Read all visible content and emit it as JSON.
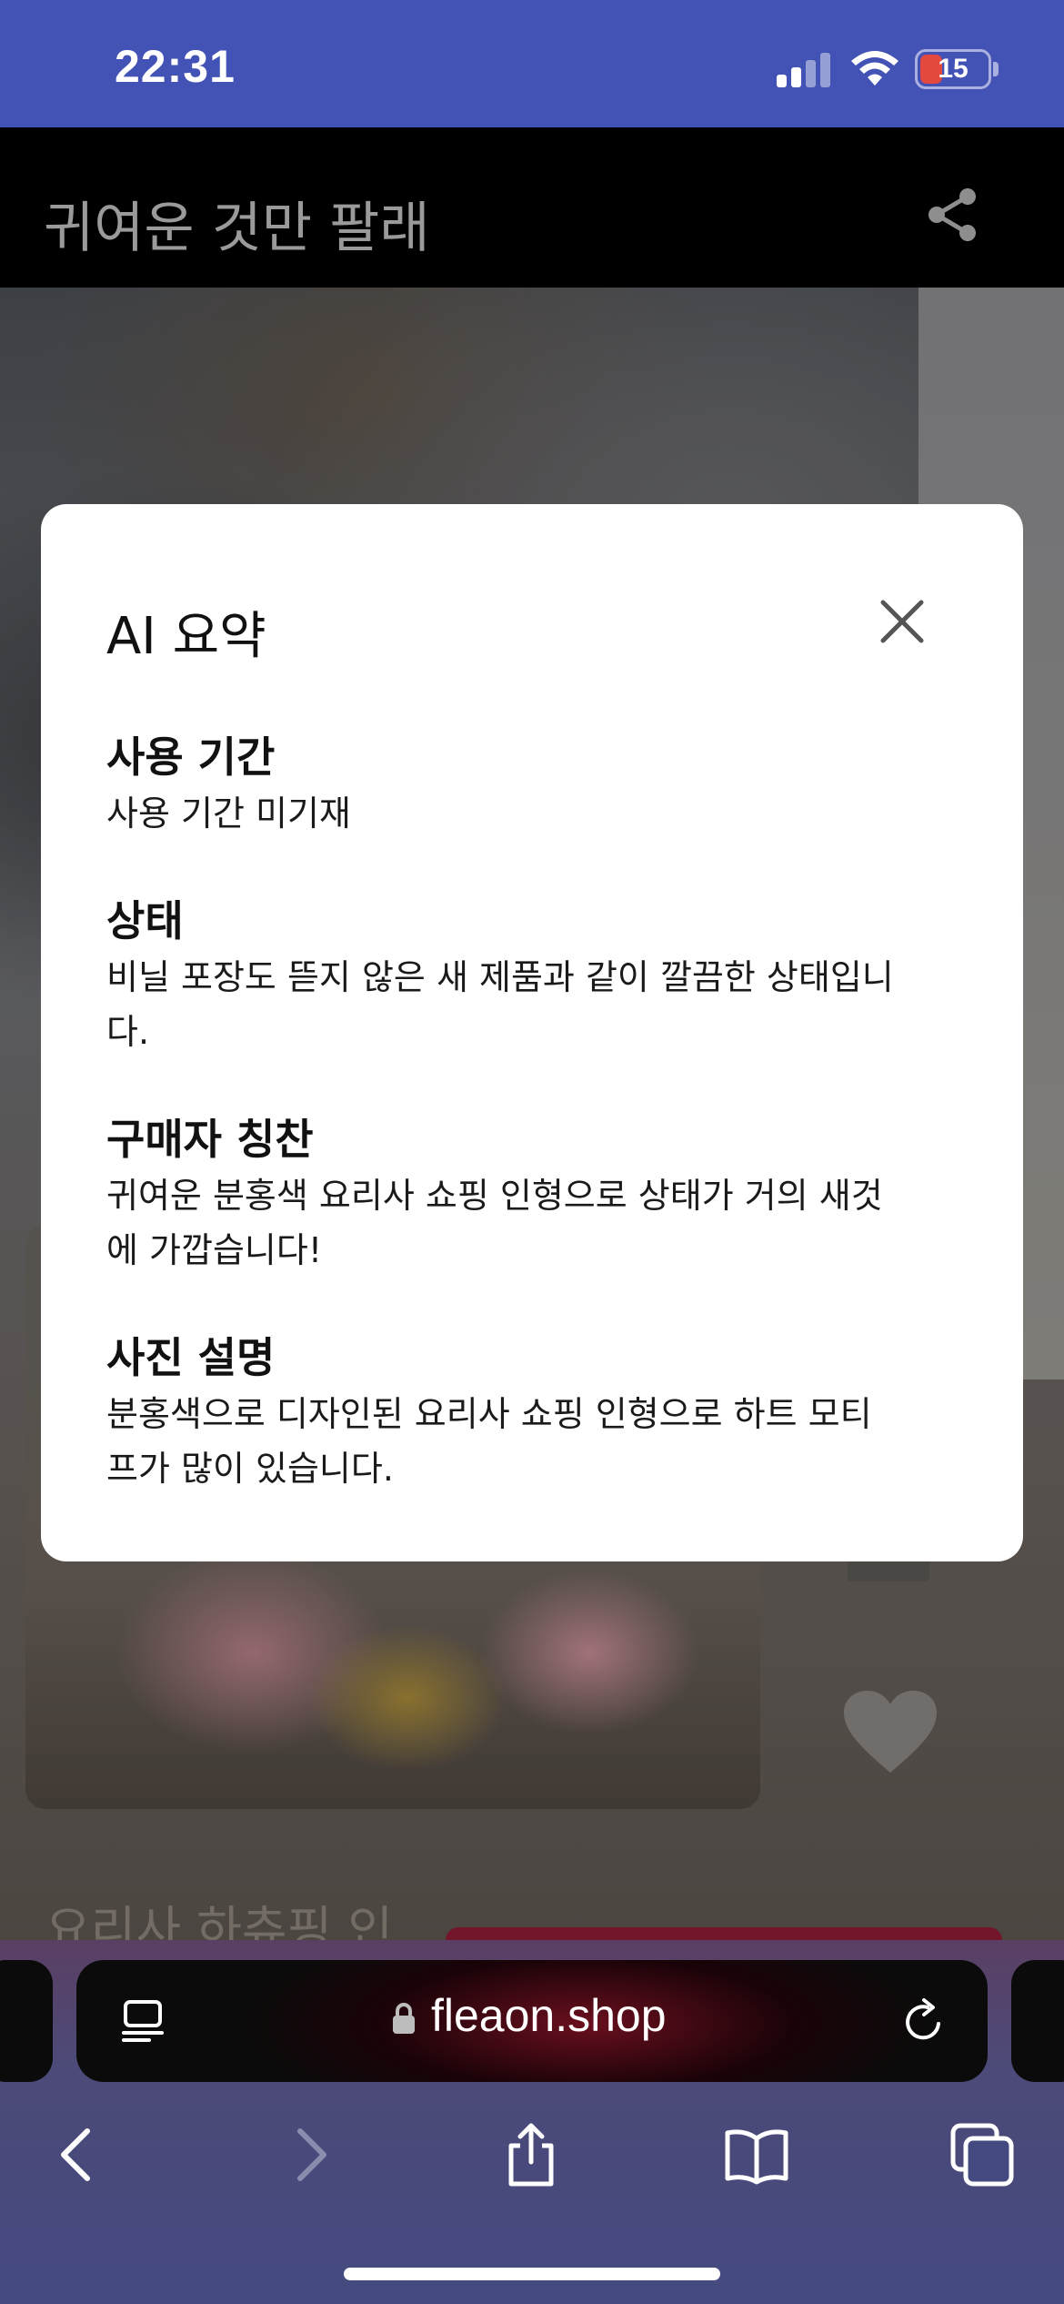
{
  "status_bar": {
    "time": "22:31",
    "battery_level": "15",
    "signal_bars_active": 2,
    "icons": [
      "cellular-signal-icon",
      "wifi-icon",
      "battery-icon"
    ]
  },
  "app_header": {
    "title": "귀여운 것만 팔래",
    "share_icon": "share-icon"
  },
  "background": {
    "product_name_partial": "요리사 하츄핑 인",
    "heart_icon": "heart-icon"
  },
  "modal": {
    "title": "AI 요약",
    "close_icon": "close-icon",
    "sections": [
      {
        "heading": "사용 기간",
        "lines": [
          "사용 기간 미기재"
        ]
      },
      {
        "heading": "상태",
        "lines": [
          "비닐 포장도 뜯지 않은 새 제품과 같이 깔끔한 상태입니",
          "다."
        ]
      },
      {
        "heading": "구매자 칭찬",
        "lines": [
          "귀여운 분홍색 요리사 쇼핑 인형으로 상태가 거의 새것",
          "에 가깝습니다!"
        ]
      },
      {
        "heading": "사진 설명",
        "lines": [
          "분홍색으로 디자인된 요리사 쇼핑 인형으로 하트 모티",
          "프가 많이 있습니다."
        ]
      }
    ]
  },
  "browser": {
    "url": "fleaon.shop",
    "icons": [
      "reader-icon",
      "lock-icon",
      "reload-icon",
      "back-icon",
      "forward-icon",
      "share-sheet-icon",
      "bookmarks-icon",
      "tabs-icon"
    ],
    "colors": {
      "status_bar": "#4352b5",
      "toolbar": "#444a80"
    }
  }
}
